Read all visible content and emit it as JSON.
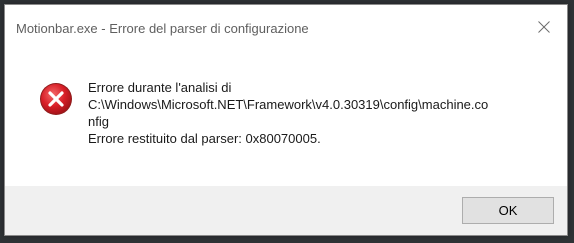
{
  "window": {
    "title": "Motionbar.exe - Errore del parser di configurazione"
  },
  "message": {
    "line1": "Errore durante l'analisi di",
    "line2": "C:\\Windows\\Microsoft.NET\\Framework\\v4.0.30319\\config\\machine.co",
    "line3": "nfig",
    "line4": "Errore restituito dal parser: 0x80070005."
  },
  "buttons": {
    "ok_label": "OK"
  },
  "icons": {
    "error": "error-icon",
    "close": "close-icon"
  },
  "colors": {
    "error_red": "#d81e27",
    "footer_bg": "#f0f0f0",
    "button_bg": "#e1e1e1"
  }
}
